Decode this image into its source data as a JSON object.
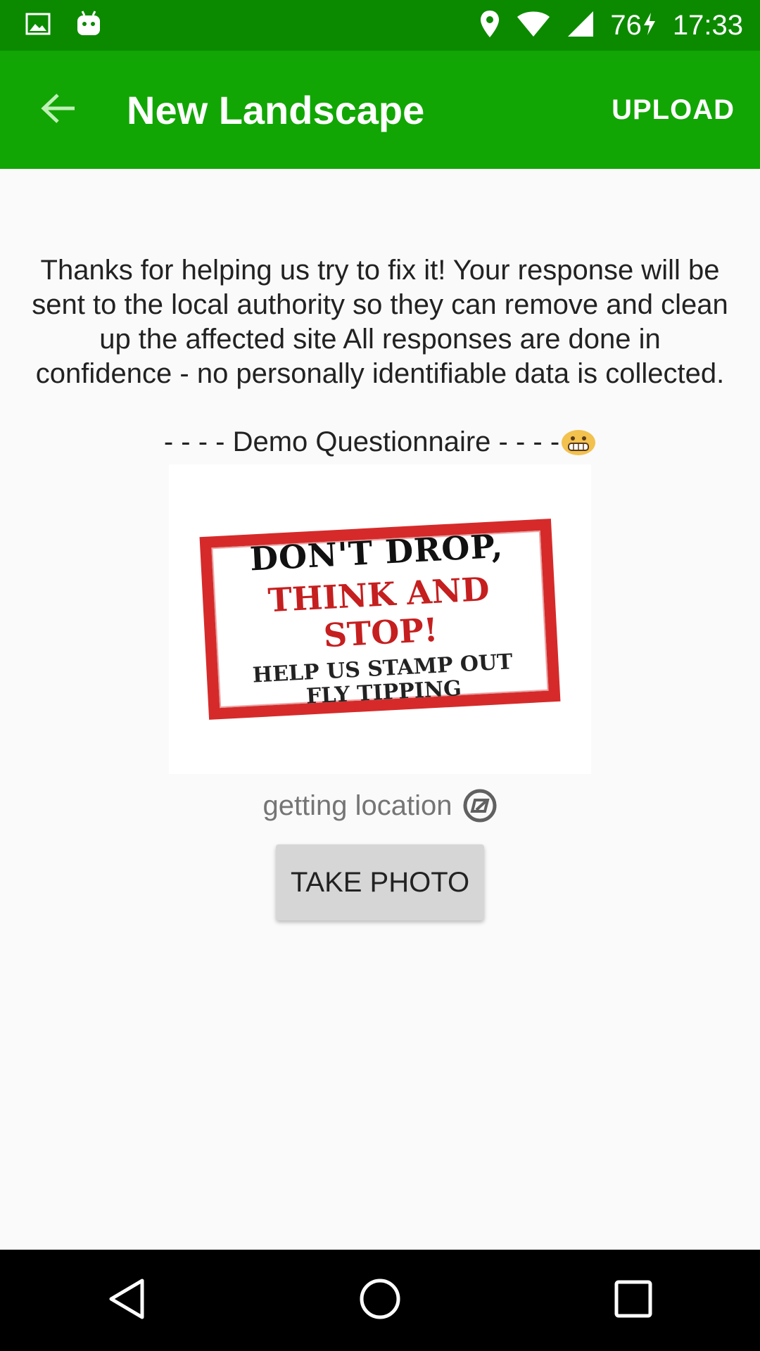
{
  "status_bar": {
    "icons": [
      "image-icon",
      "android-icon",
      "location-pin-icon",
      "wifi-icon",
      "signal-icon",
      "battery-charging-icon"
    ],
    "battery": "76",
    "time": "17:33"
  },
  "app_bar": {
    "title": "New Landscape",
    "upload_label": "UPLOAD",
    "back_icon": "back-arrow-icon"
  },
  "content": {
    "intro": "Thanks for helping us try to fix it! Your response will be sent to the local authority so they can remove and clean up the affected site All responses are done in confidence - no personally identifiable data is collected.",
    "demo_label": "- - - - Demo Questionnaire - - - -",
    "sign": {
      "line1": "DON'T DROP,",
      "line2": "THINK AND STOP!",
      "line3a": "HELP US STAMP OUT",
      "line3b": "FLY TIPPING"
    },
    "location_text": "getting location",
    "take_photo_label": "TAKE PHOTO"
  },
  "nav_bar": {
    "buttons": [
      "back-triangle-icon",
      "home-circle-icon",
      "recents-square-icon"
    ]
  },
  "colors": {
    "status_bar": "#0b8a00",
    "app_bar": "#11a603",
    "sign_red": "#d62a2a",
    "button_bg": "#d6d6d6"
  }
}
